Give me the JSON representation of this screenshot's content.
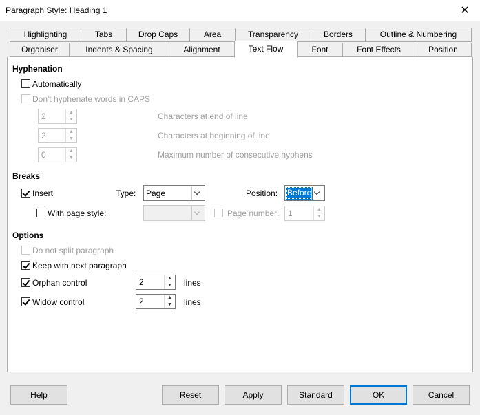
{
  "window": {
    "title": "Paragraph Style: Heading 1",
    "close_glyph": "✕"
  },
  "tabs_row1": [
    "Highlighting",
    "Tabs",
    "Drop Caps",
    "Area",
    "Transparency",
    "Borders",
    "Outline & Numbering"
  ],
  "tabs_row2": [
    "Organiser",
    "Indents & Spacing",
    "Alignment",
    "Text Flow",
    "Font",
    "Font Effects",
    "Position"
  ],
  "active_tab": "Text Flow",
  "hyphenation": {
    "heading": "Hyphenation",
    "automatically": {
      "label": "Automatically",
      "checked": false
    },
    "dont_caps": {
      "label": "Don't hyphenate words in CAPS",
      "checked": false,
      "enabled": false
    },
    "chars_end": {
      "value": "2",
      "label": "Characters at end of line"
    },
    "chars_begin": {
      "value": "2",
      "label": "Characters at beginning of line"
    },
    "max_hyphens": {
      "value": "0",
      "label": "Maximum number of consecutive hyphens"
    }
  },
  "breaks": {
    "heading": "Breaks",
    "insert": {
      "label": "Insert",
      "checked": true
    },
    "type_label": "Type:",
    "type_value": "Page",
    "position_label": "Position:",
    "position_value": "Before",
    "with_page_style": {
      "label": "With page style:",
      "checked": false
    },
    "page_style_value": "",
    "page_number": {
      "label": "Page number:",
      "value": "1",
      "checked": false
    }
  },
  "options": {
    "heading": "Options",
    "do_not_split": {
      "label": "Do not split paragraph",
      "checked": false,
      "enabled": false
    },
    "keep_with_next": {
      "label": "Keep with next paragraph",
      "checked": true
    },
    "orphan": {
      "label": "Orphan control",
      "checked": true,
      "value": "2",
      "unit": "lines"
    },
    "widow": {
      "label": "Widow control",
      "checked": true,
      "value": "2",
      "unit": "lines"
    }
  },
  "buttons": {
    "help": "Help",
    "reset": "Reset",
    "apply": "Apply",
    "standard": "Standard",
    "ok": "OK",
    "cancel": "Cancel"
  },
  "colors": {
    "accent": "#0078d7",
    "dialog_bg": "#f0f0f0",
    "panel_bg": "#ffffff",
    "disabled_text": "#9f9f9f"
  }
}
